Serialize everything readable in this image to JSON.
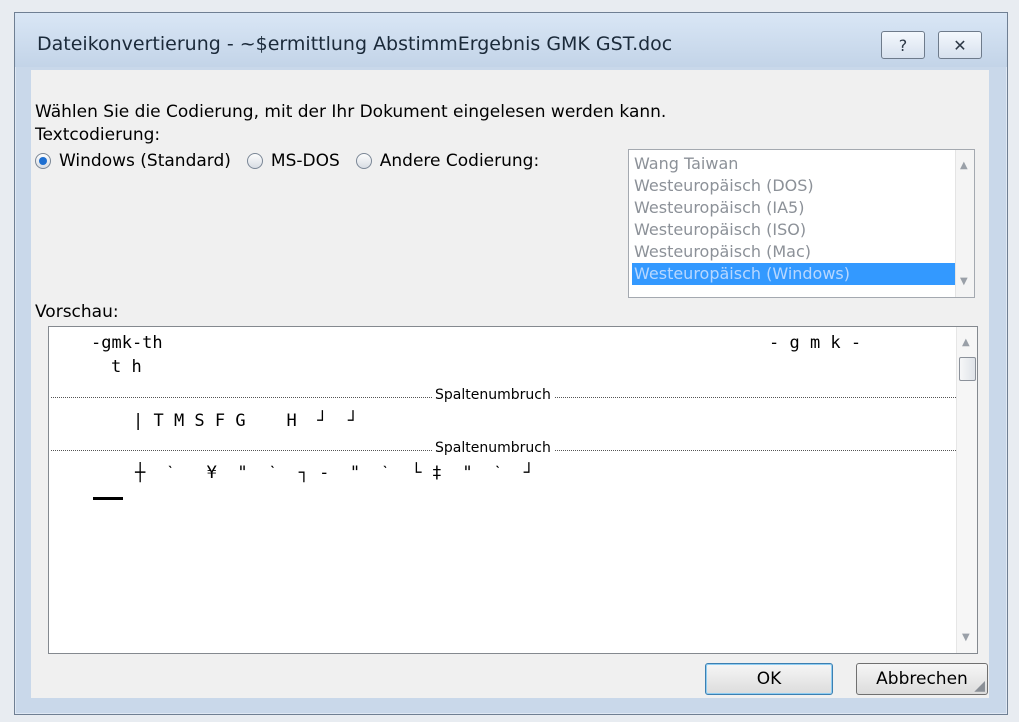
{
  "window": {
    "title": "Dateikonvertierung - ~$ermittlung AbstimmErgebnis GMK GST.doc"
  },
  "titlebar": {
    "help_glyph": "?",
    "close_glyph": "✕"
  },
  "instructions": "Wählen Sie die Codierung, mit der Ihr Dokument eingelesen werden kann.",
  "encoding_label": "Textcodierung:",
  "radios": [
    {
      "label": "Windows (Standard)",
      "checked": true
    },
    {
      "label": "MS-DOS",
      "checked": false
    },
    {
      "label": "Andere Codierung:",
      "checked": false
    }
  ],
  "encodings": [
    "Wang Taiwan",
    "Westeuropäisch (DOS)",
    "Westeuropäisch (IA5)",
    "Westeuropäisch (ISO)",
    "Westeuropäisch (Mac)",
    "Westeuropäisch (Windows)"
  ],
  "selected_encoding": "Westeuropäisch (Windows)",
  "preview": {
    "label": "Vorschau:",
    "line1_left": "-gmk-th",
    "line1_right": "- g m k -",
    "line2": "t h",
    "break_label": "Spaltenumbruch",
    "line3": "| T M S F G    H  ┘  ┘",
    "line4": "┼  ˋ   ¥  \"  ˋ  ┐ -  \"  ˋ  └ ‡  \"  ˋ  ┘"
  },
  "buttons": {
    "ok": "OK",
    "cancel": "Abbrechen"
  },
  "colors": {
    "selection": "#3399ff",
    "titlebar": "#c9d8ea"
  }
}
